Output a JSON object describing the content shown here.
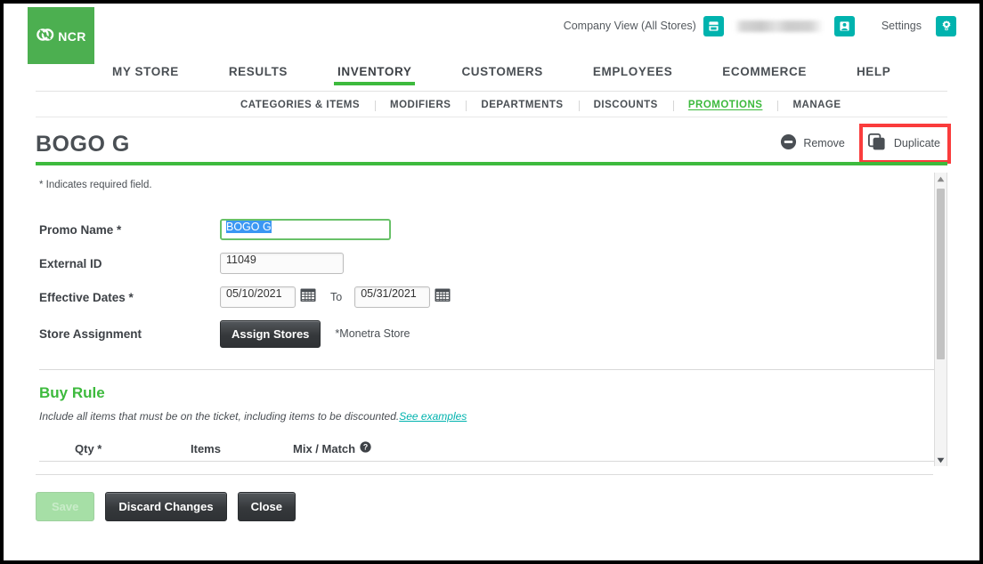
{
  "brand": {
    "logo_text": "NCR",
    "logo_color": "#4caf50",
    "accent_green": "#3dba3d",
    "accent_teal": "#00b3ae",
    "highlight_red": "#fa3c3c"
  },
  "header": {
    "company_view": "Company View (All Stores)",
    "store_icon": "store-icon",
    "user_name": "",
    "user_icon": "user-icon",
    "settings_label": "Settings",
    "settings_icon": "gear-icon"
  },
  "primary_nav": {
    "active": "INVENTORY",
    "items": [
      {
        "label": "MY STORE"
      },
      {
        "label": "RESULTS"
      },
      {
        "label": "INVENTORY"
      },
      {
        "label": "CUSTOMERS"
      },
      {
        "label": "EMPLOYEES"
      },
      {
        "label": "ECOMMERCE"
      },
      {
        "label": "HELP"
      }
    ]
  },
  "secondary_nav": {
    "active": "PROMOTIONS",
    "items": [
      {
        "label": "CATEGORIES & ITEMS"
      },
      {
        "label": "MODIFIERS"
      },
      {
        "label": "DEPARTMENTS"
      },
      {
        "label": "DISCOUNTS"
      },
      {
        "label": "PROMOTIONS"
      },
      {
        "label": "MANAGE"
      }
    ]
  },
  "title_bar": {
    "title": "BOGO G",
    "remove_label": "Remove",
    "remove_icon": "minus-circle-icon",
    "duplicate_label": "Duplicate",
    "duplicate_icon": "duplicate-icon"
  },
  "form": {
    "required_note": "* Indicates required field.",
    "promo_name": {
      "label": "Promo Name *",
      "value": "BOGO G",
      "focused": true,
      "text_selected": true
    },
    "external_id": {
      "label": "External ID",
      "value": "11049"
    },
    "effective_dates": {
      "label": "Effective Dates *",
      "start": "05/10/2021",
      "to_word": "To",
      "end": "05/31/2021",
      "calendar_icon": "calendar-icon"
    },
    "store_assignment": {
      "label": "Store Assignment",
      "button_label": "Assign Stores",
      "note": "*Monetra Store"
    }
  },
  "buy_rule": {
    "title": "Buy Rule",
    "description": "Include all items that must be on the ticket, including items to be discounted.",
    "link_label": "See examples",
    "columns": [
      {
        "label": "Qty *",
        "icon": null
      },
      {
        "label": "Items",
        "icon": null
      },
      {
        "label": "Mix / Match",
        "icon": "help-icon"
      }
    ]
  },
  "footer": {
    "save_label": "Save",
    "save_disabled": true,
    "discard_label": "Discard Changes",
    "close_label": "Close"
  },
  "scrollbar": {
    "up_icon": "caret-up-icon",
    "down_icon": "caret-down-icon",
    "thumb": "scrollbar-thumb"
  }
}
